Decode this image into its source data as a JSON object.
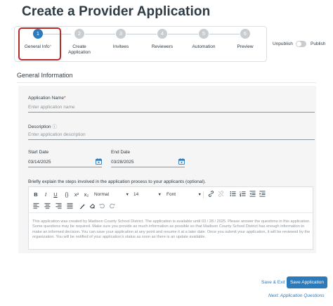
{
  "page": {
    "title": "Create a Provider Application"
  },
  "stepper": {
    "steps": [
      {
        "number": "1",
        "label": "General Info",
        "marker": "*"
      },
      {
        "number": "2",
        "label": "Create",
        "label2": "Application"
      },
      {
        "number": "3",
        "label": "Invitees"
      },
      {
        "number": "4",
        "label": "Reviewers"
      },
      {
        "number": "5",
        "label": "Automation"
      },
      {
        "number": "6",
        "label": "Preview"
      }
    ]
  },
  "publish": {
    "off_label": "Unpublish",
    "on_label": "Publish",
    "state": "unpublished"
  },
  "form": {
    "section_title": "General Information",
    "app_name": {
      "label": "Application Name",
      "required_mark": "*",
      "placeholder": "Enter application name",
      "value": ""
    },
    "description": {
      "label": "Description",
      "info_mark": "ⓘ",
      "placeholder": "Enter application description",
      "value": ""
    },
    "start_date": {
      "label": "Start Date",
      "value": "03/14/2025"
    },
    "end_date": {
      "label": "End Date",
      "value": "03/28/2025"
    }
  },
  "editor": {
    "label": "Briefly explain the steps involved in the application process to your applicants (optional).",
    "toolbar": {
      "bold": "B",
      "italic": "I",
      "underline": "U",
      "code": "{}",
      "superscript": "x²",
      "subscript": "x₂",
      "block_format": "Normal",
      "font_size": "14",
      "font_family": "Font"
    },
    "body_text": "This application was created by Madison County School District. The application is available until 03 / 28 / 2025. Please answer the questions in this application. Some questions may be required. Make sure you provide as much information as possible so that Madison County School District has enough information to make an informed decision. You can save your application at any point and resume it at a later date. Once you submit your application, it will be reviewed by the organization. You will be notified of your application's status as soon as there is an update available."
  },
  "footer": {
    "save_exit_label": "Save & Exit",
    "save_app_label": "Save Application",
    "next_prefix": "Next:",
    "next_label": "Application Questions"
  },
  "colors": {
    "accent": "#2b7abc",
    "highlight": "#b52a2a",
    "text": "#2d3b45",
    "muted": "#8b969e"
  }
}
